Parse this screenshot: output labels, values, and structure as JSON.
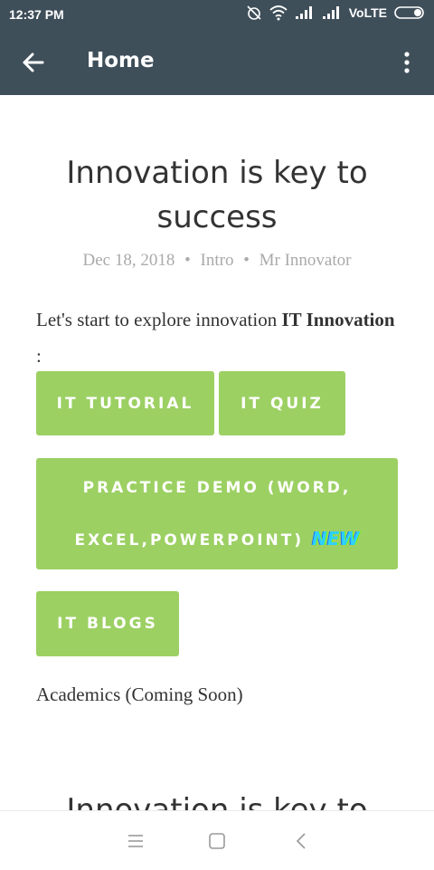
{
  "status_bar": {
    "time": "12:37 PM",
    "network": "VoLTE",
    "icons": [
      "alarm-off-icon",
      "wifi-icon",
      "signal-icon",
      "signal-icon",
      "battery-icon"
    ]
  },
  "app_bar": {
    "title": "Home",
    "back_icon": "arrow-left-icon",
    "menu_icon": "more-vert-icon"
  },
  "post": {
    "title": "Innovation is key to success",
    "meta": {
      "date": "Dec 18, 2018",
      "category": "Intro",
      "author": "Mr Innovator",
      "separator": "•"
    },
    "intro_text": "Let's start to explore innovation ",
    "intro_bold": "IT Innovation",
    "intro_suffix": " :",
    "buttons": {
      "tutorial": "IT TUTORIAL",
      "quiz": "IT QUIZ",
      "practice_line1": "PRACTICE DEMO (WORD,",
      "practice_line2": "EXCEL,POWERPOINT)",
      "new_badge": "NEW",
      "blogs": "IT BLOGS"
    },
    "academics": "Academics (Coming Soon)",
    "next_post_title": "Innovation is key to success"
  },
  "nav_bar": {
    "icons": [
      "menu-icon",
      "home-square-icon",
      "back-chevron-icon"
    ]
  },
  "colors": {
    "app_bar": "#3f4f5a",
    "button": "#9cd063",
    "text": "#333333",
    "meta": "#aaaaaa"
  }
}
